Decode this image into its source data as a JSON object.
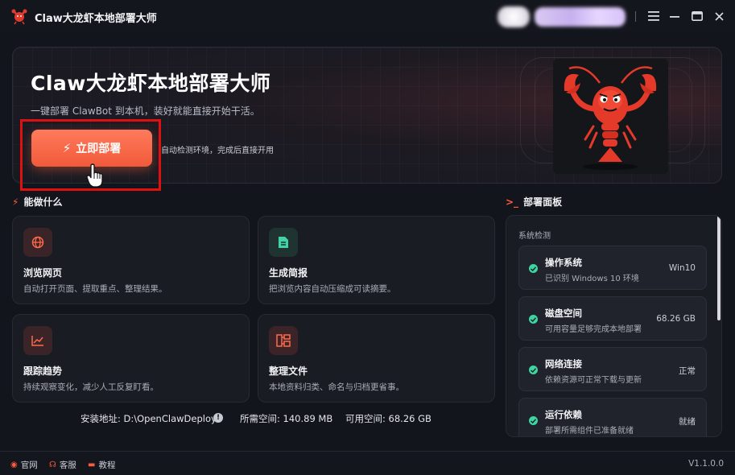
{
  "app": {
    "title": "Claw大龙虾本地部署大师"
  },
  "hero": {
    "title": "Claw大龙虾本地部署大师",
    "subtitle": "一键部署 ClawBot 到本机，装好就能直接开始干活。",
    "deploy_label": "立即部署",
    "hint": "自动检测环境，完成后直接开用"
  },
  "capabilities": {
    "title": "能做什么",
    "cards": [
      {
        "title": "浏览网页",
        "desc": "自动打开页面、提取重点、整理结果。",
        "icon": "globe-icon"
      },
      {
        "title": "生成简报",
        "desc": "把浏览内容自动压缩成可读摘要。",
        "icon": "document-icon"
      },
      {
        "title": "跟踪趋势",
        "desc": "持续观察变化，减少人工反复盯看。",
        "icon": "trend-chart-icon"
      },
      {
        "title": "整理文件",
        "desc": "本地资料归类、命名与归档更省事。",
        "icon": "folder-structure-icon"
      }
    ]
  },
  "install": {
    "path_label": "安装地址:",
    "path_value": "D:\\OpenClawDeploy",
    "required_label": "所需空间:",
    "required_value": "140.89 MB",
    "available_label": "可用空间:",
    "available_value": "68.26 GB"
  },
  "panel": {
    "title": "部署面板",
    "subtitle": "系统检测",
    "checks": [
      {
        "title": "操作系统",
        "desc": "已识别 Windows 10 环境",
        "value": "Win10"
      },
      {
        "title": "磁盘空间",
        "desc": "可用容量足够完成本地部署",
        "value": "68.26 GB"
      },
      {
        "title": "网络连接",
        "desc": "依赖资源可正常下载与更新",
        "value": "正常"
      },
      {
        "title": "运行依赖",
        "desc": "部署所需组件已准备就绪",
        "value": "就绪"
      }
    ]
  },
  "footer": {
    "links": [
      "官网",
      "客服",
      "教程"
    ],
    "version": "V1.1.0.0"
  },
  "colors": {
    "accent": "#f05a3a",
    "success": "#3dd6a3",
    "background": "#13151c",
    "card": "#1a1c23"
  }
}
